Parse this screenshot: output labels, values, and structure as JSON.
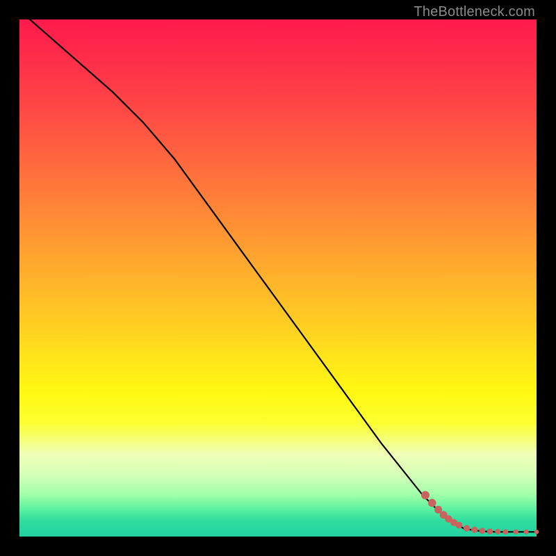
{
  "watermark": "TheBottleneck.com",
  "colors": {
    "line": "#000000",
    "marker_fill": "#c8645f",
    "marker_stroke": "#c8645f",
    "frame": "#000000"
  },
  "chart_data": {
    "type": "line",
    "title": "",
    "xlabel": "",
    "ylabel": "",
    "xlim": [
      0,
      100
    ],
    "ylim": [
      0,
      100
    ],
    "grid": false,
    "legend": false,
    "series": [
      {
        "name": "curve",
        "style": "line",
        "x": [
          2,
          10,
          18,
          24,
          30,
          38,
          46,
          54,
          62,
          70,
          78,
          82,
          86,
          88,
          90,
          92,
          94,
          96,
          98,
          100
        ],
        "y": [
          100,
          93,
          86,
          80,
          73,
          62,
          51,
          40,
          29,
          18,
          8,
          4,
          1.5,
          1.2,
          1.0,
          0.9,
          0.9,
          0.9,
          0.9,
          0.9
        ]
      },
      {
        "name": "tail-markers",
        "style": "scatter",
        "x": [
          78.5,
          79.8,
          81.0,
          82.0,
          83.0,
          84.0,
          85.0,
          86.5,
          88.0,
          89.5,
          91.0,
          92.5,
          94.0,
          96.0,
          98.0,
          100.0
        ],
        "y": [
          8.0,
          6.5,
          5.2,
          4.2,
          3.4,
          2.7,
          2.2,
          1.6,
          1.3,
          1.1,
          1.0,
          0.95,
          0.9,
          0.9,
          0.9,
          0.9
        ]
      }
    ]
  }
}
